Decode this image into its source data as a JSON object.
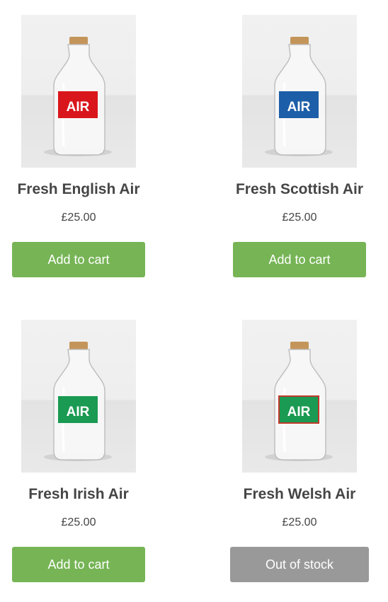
{
  "products": [
    {
      "name": "Fresh English Air",
      "price": "£25.00",
      "button_label": "Add to cart",
      "in_stock": true,
      "label_color": "#d9161b",
      "label_text": "AIR"
    },
    {
      "name": "Fresh Scottish Air",
      "price": "£25.00",
      "button_label": "Add to cart",
      "in_stock": true,
      "label_color": "#1c5ea8",
      "label_text": "AIR"
    },
    {
      "name": "Fresh Irish Air",
      "price": "£25.00",
      "button_label": "Add to cart",
      "in_stock": true,
      "label_color": "#1a9a52",
      "label_text": "AIR"
    },
    {
      "name": "Fresh Welsh Air",
      "price": "£25.00",
      "button_label": "Out of stock",
      "in_stock": false,
      "label_color": "#1a9a52",
      "label_text": "AIR"
    }
  ],
  "colors": {
    "add_button": "#76b455",
    "out_of_stock_button": "#999999"
  }
}
